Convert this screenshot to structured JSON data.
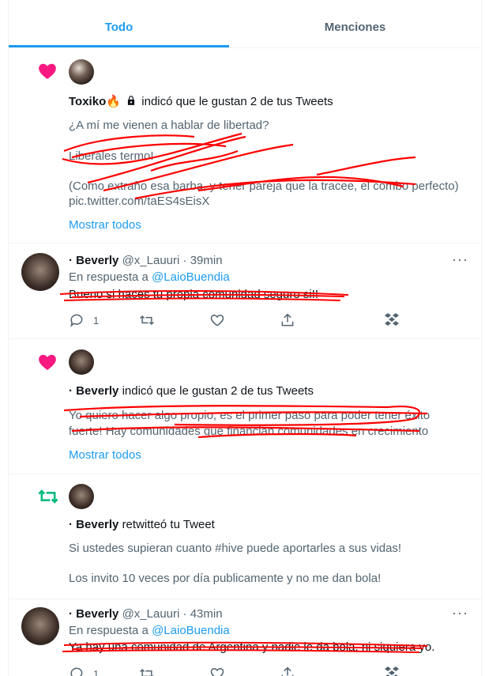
{
  "tabs": {
    "all": "Todo",
    "mentions": "Menciones"
  },
  "colors": {
    "accent": "#1d9bf0",
    "like": "#f91880",
    "retweet": "#00ba7c",
    "scribble": "#ff0000"
  },
  "notif1": {
    "icon": "heart-icon",
    "user": "Toxiko",
    "user_emoji": "🔥",
    "action": "indicó que le gustan 2 de tus Tweets",
    "lines": [
      "¿A mí me vienen a hablar de libertad?",
      "Liberales termo!",
      "(Como extraño esa barba, y tener pareja que la tracee, el combo perfecto)",
      "pic.twitter.com/taES4sEisX"
    ],
    "show_all": "Mostrar todos"
  },
  "reply1": {
    "name_prefix": "·",
    "name": "Beverly",
    "handle": "@x_Lauuri",
    "time": "39min",
    "reply_label": "En respuesta a",
    "reply_to": "@LaioBuendia",
    "text": "Bueno si haces tu propia comunidad seguro si!!",
    "reply_count": "1"
  },
  "notif2": {
    "icon": "heart-icon",
    "user_prefix": "·",
    "user": "Beverly",
    "action": "indicó que le gustan 2 de tus Tweets",
    "lines": [
      "Yo quiero hacer algo propio, es el primer paso para poder tener éxito",
      "fuerte! Hay comunidades que financian comunidades en crecimiento"
    ],
    "show_all": "Mostrar todos"
  },
  "notif3": {
    "icon": "retweet-icon",
    "user_prefix": "·",
    "user": "Beverly",
    "action": "retwitteó tu Tweet",
    "lines": [
      "Si ustedes supieran cuanto #hive puede aportarles a sus vidas!",
      "Los invito 10 veces por día publicamente y no me dan bola!"
    ]
  },
  "reply2": {
    "name_prefix": "·",
    "name": "Beverly",
    "handle": "@x_Lauuri",
    "time": "43min",
    "reply_label": "En respuesta a",
    "reply_to": "@LaioBuendia",
    "text": "Ya hay una comunidad de Argentina y nadie le da bola, ni siquiera yo.",
    "reply_count": "1"
  }
}
